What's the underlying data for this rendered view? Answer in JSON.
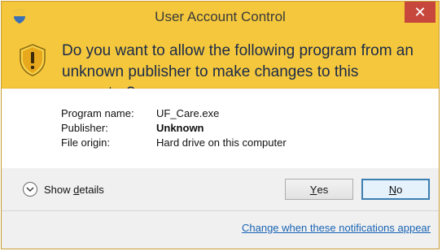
{
  "window": {
    "title": "User Account Control",
    "close_glyph": "✕"
  },
  "banner": {
    "heading": "Do you want to allow the following program from an unknown publisher to make changes to this computer?"
  },
  "details": {
    "program_name_label": "Program name:",
    "program_name_value": "UF_Care.exe",
    "publisher_label": "Publisher:",
    "publisher_value": "Unknown",
    "file_origin_label": "File origin:",
    "file_origin_value": "Hard drive on this computer"
  },
  "actions": {
    "show_details_prefix": "Show ",
    "show_details_mnemonic": "d",
    "show_details_suffix": "etails",
    "yes_mnemonic": "Y",
    "yes_rest": "es",
    "no_mnemonic": "N",
    "no_rest": "o"
  },
  "footer": {
    "notification_link": "Change when these notifications appear"
  },
  "colors": {
    "banner": "#f4c73c",
    "close": "#c7473c",
    "link": "#1a64b4"
  }
}
